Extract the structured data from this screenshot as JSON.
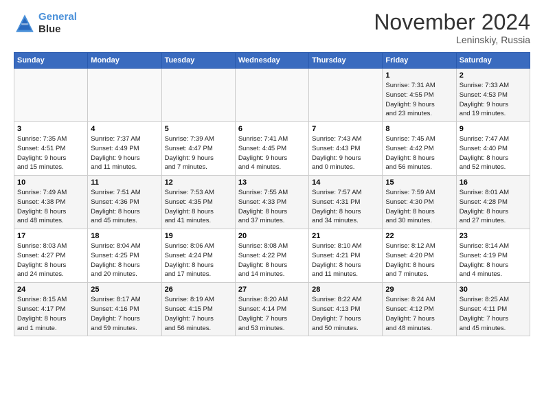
{
  "header": {
    "logo_line1": "General",
    "logo_line2": "Blue",
    "month": "November 2024",
    "location": "Leninskiy, Russia"
  },
  "days_of_week": [
    "Sunday",
    "Monday",
    "Tuesday",
    "Wednesday",
    "Thursday",
    "Friday",
    "Saturday"
  ],
  "weeks": [
    [
      {
        "day": "",
        "info": ""
      },
      {
        "day": "",
        "info": ""
      },
      {
        "day": "",
        "info": ""
      },
      {
        "day": "",
        "info": ""
      },
      {
        "day": "",
        "info": ""
      },
      {
        "day": "1",
        "info": "Sunrise: 7:31 AM\nSunset: 4:55 PM\nDaylight: 9 hours\nand 23 minutes."
      },
      {
        "day": "2",
        "info": "Sunrise: 7:33 AM\nSunset: 4:53 PM\nDaylight: 9 hours\nand 19 minutes."
      }
    ],
    [
      {
        "day": "3",
        "info": "Sunrise: 7:35 AM\nSunset: 4:51 PM\nDaylight: 9 hours\nand 15 minutes."
      },
      {
        "day": "4",
        "info": "Sunrise: 7:37 AM\nSunset: 4:49 PM\nDaylight: 9 hours\nand 11 minutes."
      },
      {
        "day": "5",
        "info": "Sunrise: 7:39 AM\nSunset: 4:47 PM\nDaylight: 9 hours\nand 7 minutes."
      },
      {
        "day": "6",
        "info": "Sunrise: 7:41 AM\nSunset: 4:45 PM\nDaylight: 9 hours\nand 4 minutes."
      },
      {
        "day": "7",
        "info": "Sunrise: 7:43 AM\nSunset: 4:43 PM\nDaylight: 9 hours\nand 0 minutes."
      },
      {
        "day": "8",
        "info": "Sunrise: 7:45 AM\nSunset: 4:42 PM\nDaylight: 8 hours\nand 56 minutes."
      },
      {
        "day": "9",
        "info": "Sunrise: 7:47 AM\nSunset: 4:40 PM\nDaylight: 8 hours\nand 52 minutes."
      }
    ],
    [
      {
        "day": "10",
        "info": "Sunrise: 7:49 AM\nSunset: 4:38 PM\nDaylight: 8 hours\nand 48 minutes."
      },
      {
        "day": "11",
        "info": "Sunrise: 7:51 AM\nSunset: 4:36 PM\nDaylight: 8 hours\nand 45 minutes."
      },
      {
        "day": "12",
        "info": "Sunrise: 7:53 AM\nSunset: 4:35 PM\nDaylight: 8 hours\nand 41 minutes."
      },
      {
        "day": "13",
        "info": "Sunrise: 7:55 AM\nSunset: 4:33 PM\nDaylight: 8 hours\nand 37 minutes."
      },
      {
        "day": "14",
        "info": "Sunrise: 7:57 AM\nSunset: 4:31 PM\nDaylight: 8 hours\nand 34 minutes."
      },
      {
        "day": "15",
        "info": "Sunrise: 7:59 AM\nSunset: 4:30 PM\nDaylight: 8 hours\nand 30 minutes."
      },
      {
        "day": "16",
        "info": "Sunrise: 8:01 AM\nSunset: 4:28 PM\nDaylight: 8 hours\nand 27 minutes."
      }
    ],
    [
      {
        "day": "17",
        "info": "Sunrise: 8:03 AM\nSunset: 4:27 PM\nDaylight: 8 hours\nand 24 minutes."
      },
      {
        "day": "18",
        "info": "Sunrise: 8:04 AM\nSunset: 4:25 PM\nDaylight: 8 hours\nand 20 minutes."
      },
      {
        "day": "19",
        "info": "Sunrise: 8:06 AM\nSunset: 4:24 PM\nDaylight: 8 hours\nand 17 minutes."
      },
      {
        "day": "20",
        "info": "Sunrise: 8:08 AM\nSunset: 4:22 PM\nDaylight: 8 hours\nand 14 minutes."
      },
      {
        "day": "21",
        "info": "Sunrise: 8:10 AM\nSunset: 4:21 PM\nDaylight: 8 hours\nand 11 minutes."
      },
      {
        "day": "22",
        "info": "Sunrise: 8:12 AM\nSunset: 4:20 PM\nDaylight: 8 hours\nand 7 minutes."
      },
      {
        "day": "23",
        "info": "Sunrise: 8:14 AM\nSunset: 4:19 PM\nDaylight: 8 hours\nand 4 minutes."
      }
    ],
    [
      {
        "day": "24",
        "info": "Sunrise: 8:15 AM\nSunset: 4:17 PM\nDaylight: 8 hours\nand 1 minute."
      },
      {
        "day": "25",
        "info": "Sunrise: 8:17 AM\nSunset: 4:16 PM\nDaylight: 7 hours\nand 59 minutes."
      },
      {
        "day": "26",
        "info": "Sunrise: 8:19 AM\nSunset: 4:15 PM\nDaylight: 7 hours\nand 56 minutes."
      },
      {
        "day": "27",
        "info": "Sunrise: 8:20 AM\nSunset: 4:14 PM\nDaylight: 7 hours\nand 53 minutes."
      },
      {
        "day": "28",
        "info": "Sunrise: 8:22 AM\nSunset: 4:13 PM\nDaylight: 7 hours\nand 50 minutes."
      },
      {
        "day": "29",
        "info": "Sunrise: 8:24 AM\nSunset: 4:12 PM\nDaylight: 7 hours\nand 48 minutes."
      },
      {
        "day": "30",
        "info": "Sunrise: 8:25 AM\nSunset: 4:11 PM\nDaylight: 7 hours\nand 45 minutes."
      }
    ]
  ]
}
